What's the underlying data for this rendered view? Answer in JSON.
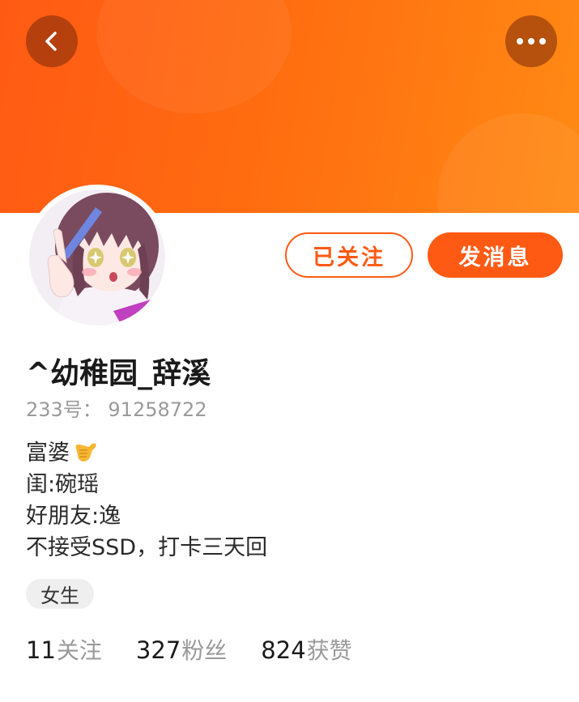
{
  "header": {
    "back_icon": "back-arrow-icon",
    "more_icon": "more-dots-icon",
    "banner_color": "#ff6a12"
  },
  "actions": {
    "follow_label": "已关注",
    "message_label": "发消息",
    "accent_color": "#ff5a14"
  },
  "profile": {
    "avatar_icon": "anime-girl-avatar",
    "username": "^幼稚园_辞溪",
    "uid_text": "233号： 91258722",
    "bio_lines": [
      "富婆",
      "闺:碗瑶",
      "好朋友:逸",
      "不接受SSD，打卡三天回"
    ],
    "bio_emoji": "call-me-hand-icon",
    "gender_tag": "女生"
  },
  "stats": [
    {
      "count": "11",
      "label": "关注"
    },
    {
      "count": "327",
      "label": "粉丝"
    },
    {
      "count": "824",
      "label": "获赞"
    }
  ]
}
